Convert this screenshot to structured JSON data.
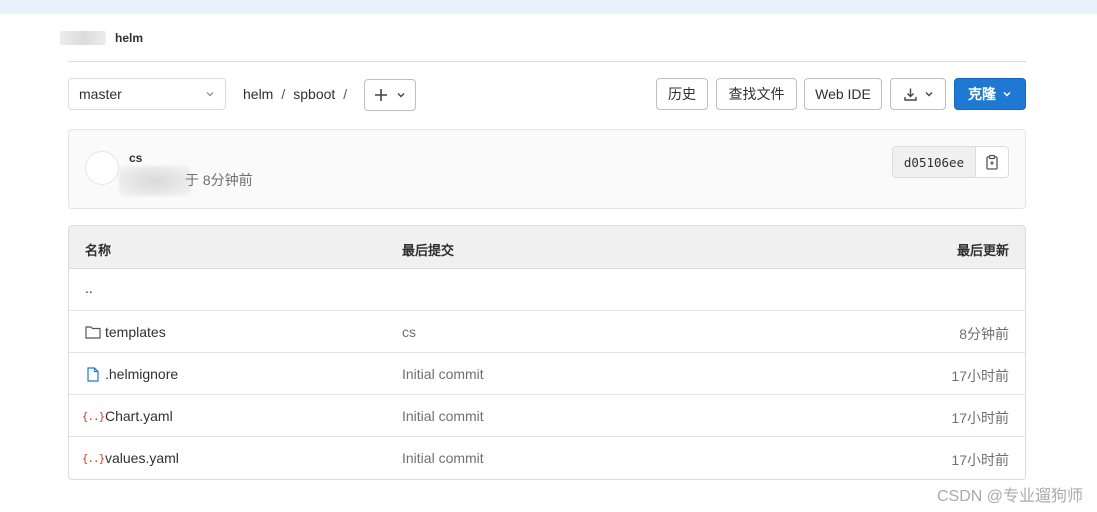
{
  "breadcrumb": {
    "project": "helm"
  },
  "toolbar": {
    "branch": "master",
    "path": [
      "helm",
      "spboot"
    ],
    "history_label": "历史",
    "find_file_label": "查找文件",
    "web_ide_label": "Web IDE",
    "clone_label": "克隆"
  },
  "commit": {
    "title": "cs",
    "time_text": "于 8分钟前",
    "sha": "d05106ee"
  },
  "tree": {
    "headers": {
      "name": "名称",
      "last_commit": "最后提交",
      "last_update": "最后更新"
    },
    "parent": "..",
    "rows": [
      {
        "name": "templates",
        "icon": "folder-icon",
        "commit": "cs",
        "updated": "8分钟前"
      },
      {
        "name": ".helmignore",
        "icon": "file-icon",
        "commit": "Initial commit",
        "updated": "17小时前"
      },
      {
        "name": "Chart.yaml",
        "icon": "yaml-icon",
        "commit": "Initial commit",
        "updated": "17小时前"
      },
      {
        "name": "values.yaml",
        "icon": "yaml-icon",
        "commit": "Initial commit",
        "updated": "17小时前"
      }
    ]
  },
  "watermark": "CSDN @专业遛狗师",
  "colors": {
    "primary": "#1f78d1",
    "yaml_icon": "#db3b21",
    "file_icon": "#1f78d1"
  }
}
